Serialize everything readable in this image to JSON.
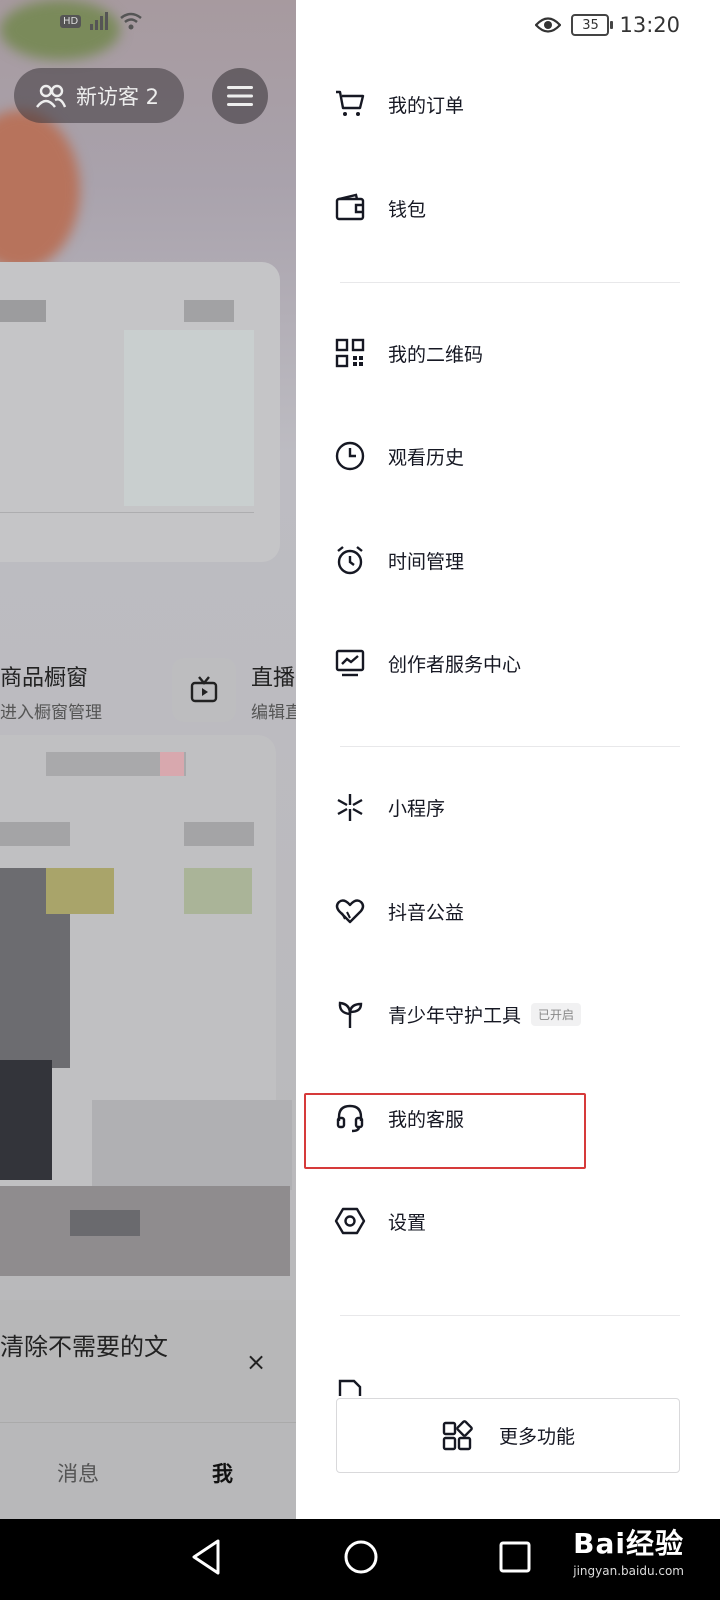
{
  "status_bar": {
    "left_icons": [
      "hd-icon",
      "4g-signal-icon",
      "wifi-icon"
    ],
    "battery": "35",
    "time": "13:20"
  },
  "background_app": {
    "visitor_pill": "新访客 2",
    "shop_label": "商品橱窗",
    "shop_sub": "进入橱窗管理",
    "live_label": "直播",
    "live_sub": "编辑直",
    "banner_text": "清除不需要的文",
    "banner_close": "×",
    "tabs": {
      "messages": "消息",
      "me": "我"
    }
  },
  "drawer": {
    "items": [
      {
        "label": "我的订单",
        "icon": "cart-icon"
      },
      {
        "label": "钱包",
        "icon": "wallet-icon"
      },
      {
        "label": "我的二维码",
        "icon": "qr-code-icon"
      },
      {
        "label": "观看历史",
        "icon": "clock-icon"
      },
      {
        "label": "时间管理",
        "icon": "alarm-clock-icon"
      },
      {
        "label": "创作者服务中心",
        "icon": "chart-monitor-icon"
      },
      {
        "label": "小程序",
        "icon": "mini-program-icon"
      },
      {
        "label": "抖音公益",
        "icon": "heart-hands-icon"
      },
      {
        "label": "青少年守护工具",
        "icon": "sprout-icon",
        "badge": "已开启"
      },
      {
        "label": "我的客服",
        "icon": "headset-icon"
      },
      {
        "label": "设置",
        "icon": "settings-hexagon-icon"
      }
    ],
    "more_button": "更多功能"
  },
  "watermark": {
    "main": "Bai经验",
    "sub": "jingyan.baidu.com"
  },
  "accent": {
    "highlight": "#d63a3a"
  }
}
